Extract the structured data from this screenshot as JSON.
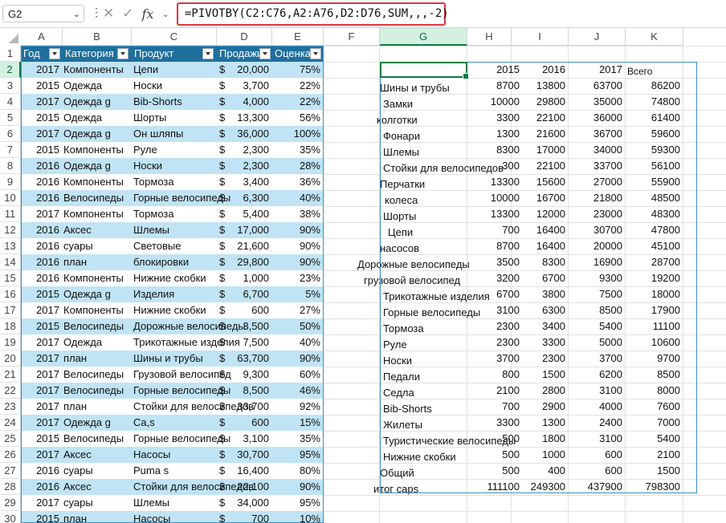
{
  "name_box": "G2",
  "formula": "=PIVOTBY(C2:C76,A2:A76,D2:D76,SUM,,,-2)",
  "columns": [
    "A",
    "B",
    "C",
    "D",
    "E",
    "F",
    "G",
    "H",
    "I",
    "J",
    "K"
  ],
  "rows": [
    "1",
    "2",
    "3",
    "4",
    "5",
    "6",
    "7",
    "8",
    "9",
    "10",
    "11",
    "12",
    "13",
    "14",
    "15",
    "16",
    "17",
    "18",
    "19",
    "20",
    "21",
    "22",
    "23",
    "24",
    "25",
    "26",
    "27",
    "28",
    "29",
    "30"
  ],
  "table_headers": [
    "Год",
    "Категория",
    "Продукт",
    "Продажи",
    "Оценка"
  ],
  "table_rows": [
    [
      "2017",
      "Компоненты",
      "Цепи",
      "$",
      "20,000",
      "75%"
    ],
    [
      "2015",
      "Одежда",
      "Носки",
      "$",
      "3,700",
      "22%"
    ],
    [
      "2017",
      "Одежда g",
      "Bib-Shorts",
      "$",
      "4,000",
      "22%"
    ],
    [
      "2015",
      "Одежда",
      "Шорты",
      "$",
      "13,300",
      "56%"
    ],
    [
      "2017",
      "Одежда g",
      "Он шляпы",
      "$",
      "36,000",
      "100%"
    ],
    [
      "2015",
      "Компоненты",
      "Руле",
      "$",
      "2,300",
      "35%"
    ],
    [
      "2016",
      "Одежда g",
      "Носки",
      "$",
      "2,300",
      "28%"
    ],
    [
      "2016",
      "Компоненты",
      "Тормоза",
      "$",
      "3,400",
      "36%"
    ],
    [
      "2016",
      "Велосипеды",
      "Горные велосипеды",
      "$",
      "6,300",
      "40%"
    ],
    [
      "2017",
      "Компоненты",
      "Тормоза",
      "$",
      "5,400",
      "38%"
    ],
    [
      "2016",
      "Аксес",
      "Шлемы",
      "$",
      "17,000",
      "90%"
    ],
    [
      "2016",
      "суары",
      "Световые",
      "$",
      "21,600",
      "90%"
    ],
    [
      "2016",
      "план",
      "блокировки",
      "$",
      "29,800",
      "90%"
    ],
    [
      "2016",
      "Компоненты",
      "Нижние скобки",
      "$",
      "1,000",
      "23%"
    ],
    [
      "2015",
      "Одежда g",
      "Изделия",
      "$",
      "6,700",
      "5%"
    ],
    [
      "2017",
      "Компоненты",
      "Нижние скобки",
      "$",
      "600",
      "27%"
    ],
    [
      "2015",
      "Велосипеды",
      "Дорожные велосипеды",
      "$",
      "3,500",
      "50%"
    ],
    [
      "2017",
      "Одежда",
      "Трикотажные изделия",
      "$",
      "7,500",
      "40%"
    ],
    [
      "2017",
      "план",
      "Шины и трубы",
      "$",
      "63,700",
      "90%"
    ],
    [
      "2017",
      "Велосипеды",
      "Грузовой велосипед",
      "$",
      "9,300",
      "60%"
    ],
    [
      "2017",
      "Велосипеды",
      "Горные велосипеды",
      "$",
      "8,500",
      "46%"
    ],
    [
      "2017",
      "план",
      "Стойки для велосипедов",
      "$",
      "33,700",
      "92%"
    ],
    [
      "2017",
      "Одежда g",
      "Ca,s",
      "$",
      "600",
      "15%"
    ],
    [
      "2015",
      "Велосипеды",
      "Горные велосипеды",
      "$",
      "3,100",
      "35%"
    ],
    [
      "2017",
      "Аксес",
      "Насосы",
      "$",
      "30,700",
      "95%"
    ],
    [
      "2016",
      "суары",
      "Puma s",
      "$",
      "16,400",
      "80%"
    ],
    [
      "2016",
      "Аксес",
      "Стойки для велосипедов",
      "$",
      "22,100",
      "90%"
    ],
    [
      "2017",
      "суары",
      "Шлемы",
      "$",
      "34,000",
      "95%"
    ],
    [
      "2015",
      "план",
      "Насосы",
      "$",
      "700",
      "10%"
    ]
  ],
  "pivot_header": [
    "2015",
    "2016",
    "2017",
    "Всего"
  ],
  "pivot_rows": [
    [
      "Шины и трубы",
      "8700",
      "13800",
      "63700",
      "86200"
    ],
    [
      "Замки",
      "10000",
      "29800",
      "35000",
      "74800"
    ],
    [
      "колготки",
      "3300",
      "22100",
      "36000",
      "61400"
    ],
    [
      "Фонари",
      "1300",
      "21600",
      "36700",
      "59600"
    ],
    [
      "Шлемы",
      "8300",
      "17000",
      "34000",
      "59300"
    ],
    [
      "Стойки для велосипедов",
      "300",
      "22100",
      "33700",
      "56100"
    ],
    [
      "Перчатки",
      "13300",
      "15600",
      "27000",
      "55900"
    ],
    [
      "колеса",
      "10000",
      "16700",
      "21800",
      "48500"
    ],
    [
      "Шорты",
      "13300",
      "12000",
      "23000",
      "48300"
    ],
    [
      "Цепи",
      "700",
      "16400",
      "30700",
      "47800"
    ],
    [
      "насосов",
      "8700",
      "16400",
      "20000",
      "45100"
    ],
    [
      "Дорожные велосипеды",
      "3500",
      "8300",
      "16900",
      "28700"
    ],
    [
      "грузовой велосипед",
      "3200",
      "6700",
      "9300",
      "19200"
    ],
    [
      "Трикотажные изделия",
      "6700",
      "3800",
      "7500",
      "18000"
    ],
    [
      "Горные велосипеды",
      "3100",
      "6300",
      "8500",
      "17900"
    ],
    [
      "Тормоза",
      "2300",
      "3400",
      "5400",
      "11100"
    ],
    [
      "Руле",
      "2300",
      "3300",
      "5000",
      "10600"
    ],
    [
      "Носки",
      "3700",
      "2300",
      "3700",
      "9700"
    ],
    [
      "Педали",
      "800",
      "1500",
      "6200",
      "8500"
    ],
    [
      "Седла",
      "2100",
      "2800",
      "3100",
      "8000"
    ],
    [
      "Bib-Shorts",
      "700",
      "2900",
      "4000",
      "7600"
    ],
    [
      "Жилеты",
      "3300",
      "1300",
      "2400",
      "7000"
    ],
    [
      "Туристические велосипеды",
      "500",
      "1800",
      "3100",
      "5400"
    ],
    [
      "Нижние скобки",
      "500",
      "1000",
      "600",
      "2100"
    ],
    [
      "Общий",
      "500",
      "400",
      "600",
      "1500"
    ],
    [
      "итог caps",
      "111100",
      "249300",
      "437900",
      "798300"
    ]
  ]
}
